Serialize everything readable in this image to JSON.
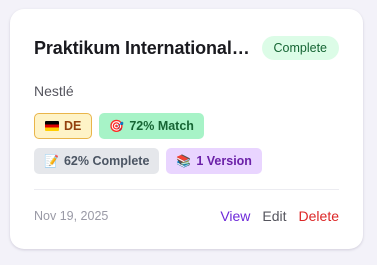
{
  "card": {
    "title": "Praktikum International ...",
    "status": "Complete",
    "company": "Nestlé",
    "badges": {
      "language": {
        "icon": "german-flag-icon",
        "label": "DE"
      },
      "match": {
        "icon": "🎯",
        "label": "72% Match"
      },
      "completeness": {
        "icon": "📝",
        "label": "62% Complete"
      },
      "versions": {
        "icon": "📚",
        "label": "1 Version"
      }
    },
    "date": "Nov 19, 2025",
    "actions": {
      "view": "View",
      "edit": "Edit",
      "delete": "Delete"
    }
  },
  "colors": {
    "status_bg": "#dcfce7",
    "match_bg": "#a7f3c7",
    "version_bg": "#e9d5ff",
    "view": "#6d28d9",
    "delete": "#dc2626"
  }
}
